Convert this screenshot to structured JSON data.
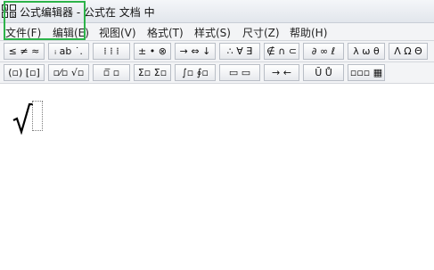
{
  "window": {
    "title": "公式编辑器 - 公式在 文档 中"
  },
  "menu": {
    "items": [
      "文件(F)",
      "编辑(E)",
      "视图(V)",
      "格式(T)",
      "样式(S)",
      "尺寸(Z)",
      "帮助(H)"
    ]
  },
  "toolbar_row1": {
    "buttons": [
      "≤ ≠ ≈",
      "ᵢ ab ˙.",
      "⁞ ⁞ ⁞",
      "± • ⊗",
      "→ ⇔ ↓",
      "∴ ∀ ∃",
      "∉ ∩ ⊂",
      "∂ ∞ ℓ",
      "λ ω θ",
      "Λ Ω Θ"
    ]
  },
  "toolbar_row2": {
    "buttons": [
      "(▫) [▫]",
      "▫⁄▫ √▫",
      "▫̅ ▫",
      "Σ▫ Σ▫",
      "∫▫ ∮▫",
      "▭ ▭",
      "→ ←",
      "Ū Ů",
      "▫▫▫ ▦"
    ]
  },
  "editor": {
    "radical_symbol": "√",
    "colors": {
      "highlight": "#2db34a",
      "titlebar": "#e8ebef",
      "toolbar": "#f3f4f6"
    }
  }
}
